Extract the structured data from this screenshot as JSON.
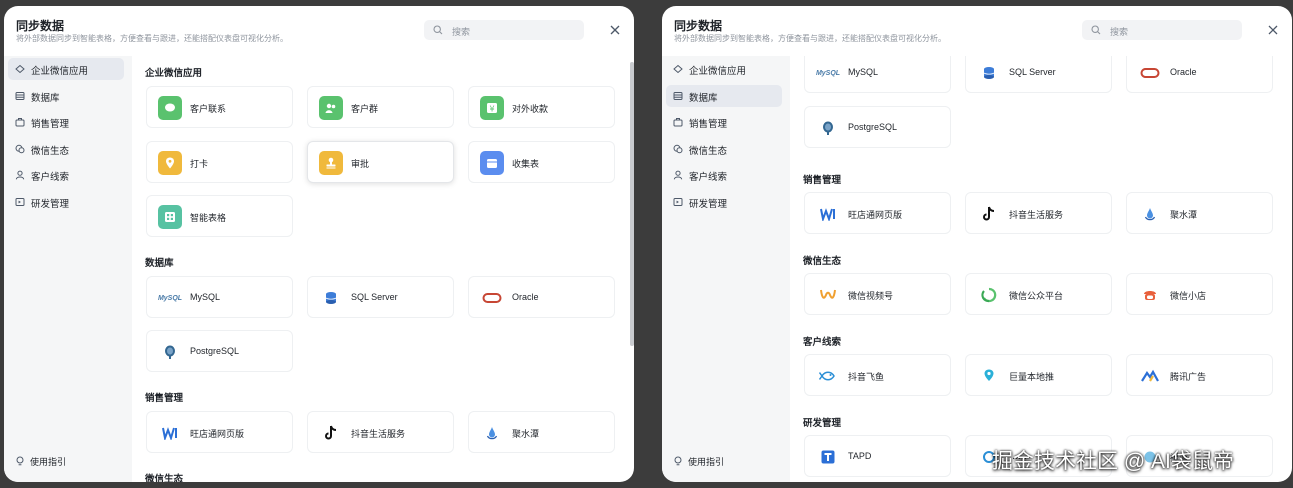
{
  "dialog": {
    "title": "同步数据",
    "subtitle": "将外部数据同步到智能表格，方便查看与跟进，还能搭配仪表盘可视化分析。",
    "search_placeholder": "搜索"
  },
  "sidebar": {
    "items": [
      "企业微信应用",
      "数据库",
      "销售管理",
      "微信生态",
      "客户线索",
      "研发管理"
    ],
    "guide": "使用指引"
  },
  "sections": {
    "wecom": "企业微信应用",
    "db": "数据库",
    "sales": "销售管理",
    "wechat": "微信生态",
    "lead": "客户线索",
    "dev": "研发管理"
  },
  "cards": {
    "contact": "客户联系",
    "group": "客户群",
    "payment": "对外收款",
    "checkin": "打卡",
    "approval": "审批",
    "form": "收集表",
    "smartsheet": "智能表格",
    "mysql": "MySQL",
    "sqlserver": "SQL Server",
    "oracle": "Oracle",
    "postgres": "PostgreSQL",
    "wangdian": "旺店通网页版",
    "douyin_life": "抖音生活服务",
    "jushuitan": "聚水潭",
    "channels": "微信视频号",
    "mp": "微信公众平台",
    "shop": "微信小店",
    "feiyu": "抖音飞鱼",
    "juliang": "巨量本地推",
    "tencent_ad": "腾讯广告",
    "tapd": "TAPD",
    "partial2": "……",
    "partial3": "禅道"
  },
  "icons": {
    "mysql_logo_text": "MySQL"
  },
  "watermark": "掘金技术社区 @ AI袋鼠帝",
  "colors": {
    "green": "#5ac26e",
    "yellow": "#f0b93c",
    "blue": "#5b8def",
    "teal": "#57c2a2",
    "sidebar_active": "#e6e9ef"
  }
}
